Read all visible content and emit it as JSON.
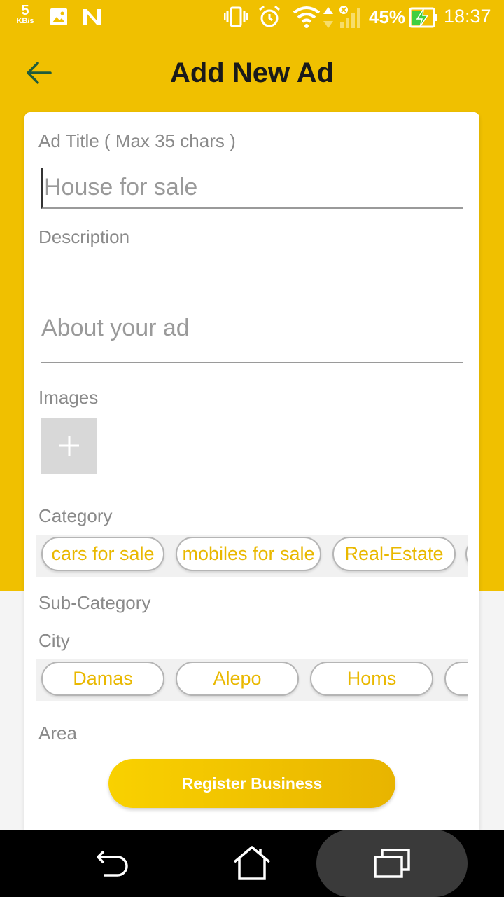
{
  "status_bar": {
    "net_speed_value": "5",
    "net_speed_unit": "KB/s",
    "battery_percent": "45%",
    "time": "18:37",
    "icons": [
      "image-icon",
      "n-notification-icon",
      "vibrate-icon",
      "alarm-icon",
      "wifi-icon",
      "data-transfer-icon",
      "signal-icon",
      "battery-charging-icon"
    ]
  },
  "header": {
    "title": "Add New Ad",
    "back_icon": "arrow-left-icon",
    "back_icon_color": "#1f5c3a"
  },
  "form": {
    "title_label": "Ad Title ( Max 35 chars )",
    "title_placeholder": "House for sale",
    "description_label": "Description",
    "description_placeholder": "About your ad",
    "images_label": "Images",
    "add_image_icon": "plus-icon",
    "category_label": "Category",
    "categories": [
      "cars for sale",
      "mobiles for sale",
      "Real-Estate"
    ],
    "subcategory_label": "Sub-Category",
    "city_label": "City",
    "cities": [
      "Damas",
      "Alepo",
      "Homs"
    ],
    "area_label": "Area",
    "submit_label": "Register Business"
  },
  "nav_bar": {
    "icons": [
      "back-nav-icon",
      "home-icon",
      "recents-icon"
    ]
  },
  "colors": {
    "primary": "#f0c000",
    "chip_text": "#e9b800",
    "label": "#8a8a8a",
    "title_text": "#1a1a1a"
  }
}
